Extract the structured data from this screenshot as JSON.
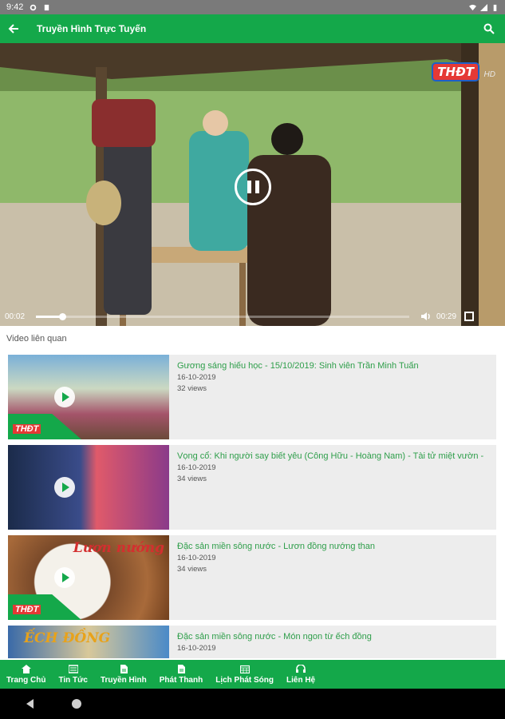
{
  "status_bar": {
    "time": "9:42",
    "icons": [
      "settings-icon",
      "sd-card-icon",
      "wifi-icon",
      "signal-icon",
      "battery-icon"
    ]
  },
  "app_bar": {
    "title": "Truyền Hình Trực Tuyến",
    "icons": [
      "back-arrow-icon",
      "search-icon"
    ]
  },
  "player": {
    "channel_logo": "THĐT",
    "quality": "HD",
    "elapsed": "00:02",
    "duration": "00:29",
    "progress": 0.07,
    "state": "playing"
  },
  "related": {
    "label": "Video liên quan",
    "items": [
      {
        "title": "Gương sáng hiếu học - 15/10/2019: Sinh viên Trần Minh Tuấn",
        "date": "16-10-2019",
        "views": "32 views",
        "logo": "THĐT",
        "thumb_caption": ""
      },
      {
        "title": "Vọng cổ: Khi người say biết yêu (Công Hữu - Hoàng Nam) - Tài tử miệt vườn -",
        "date": "16-10-2019",
        "views": "34 views",
        "logo": "",
        "thumb_caption": ""
      },
      {
        "title": "Đặc sản miền sông nước - Lươn đồng nướng than",
        "date": "16-10-2019",
        "views": "34 views",
        "logo": "THĐT",
        "thumb_caption": "Lươn nướng"
      },
      {
        "title": "Đặc sản miền sông nước - Món ngon từ ếch đồng",
        "date": "16-10-2019",
        "views": "",
        "logo": "",
        "thumb_caption": "ẾCH ĐỒNG"
      }
    ]
  },
  "bottom_nav": {
    "items": [
      {
        "label": "Trang Chủ",
        "icon": "home-icon"
      },
      {
        "label": "Tin Tức",
        "icon": "news-icon"
      },
      {
        "label": "Truyền Hình",
        "icon": "tv-file-icon"
      },
      {
        "label": "Phát Thanh",
        "icon": "radio-file-icon"
      },
      {
        "label": "Lịch Phát Sóng",
        "icon": "calendar-icon"
      },
      {
        "label": "Liên Hệ",
        "icon": "headset-icon"
      }
    ]
  },
  "colors": {
    "brand_green": "#14a84a",
    "title_green": "#2e9e4a",
    "logo_red": "#e53935"
  }
}
